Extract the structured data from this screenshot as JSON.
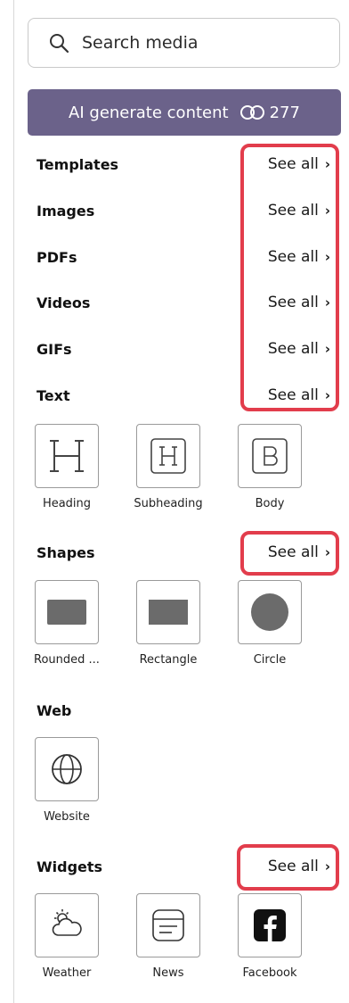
{
  "search": {
    "placeholder": "Search media",
    "icon": "search-icon"
  },
  "ai_button": {
    "label": "AI generate content",
    "credits": "277",
    "credits_icon": "credits-icon",
    "background": "#6b628a"
  },
  "sections": [
    {
      "title": "Templates",
      "see_all": "See all"
    },
    {
      "title": "Images",
      "see_all": "See all"
    },
    {
      "title": "PDFs",
      "see_all": "See all"
    },
    {
      "title": "Videos",
      "see_all": "See all"
    },
    {
      "title": "GIFs",
      "see_all": "See all"
    },
    {
      "title": "Text",
      "see_all": "See all"
    }
  ],
  "text_items": [
    {
      "label": "Heading",
      "icon": "heading-icon"
    },
    {
      "label": "Subheading",
      "icon": "subheading-icon"
    },
    {
      "label": "Body",
      "icon": "body-text-icon"
    }
  ],
  "shapes": {
    "title": "Shapes",
    "see_all": "See all",
    "items": [
      {
        "label": "Rounded ...",
        "icon": "rounded-rectangle-icon"
      },
      {
        "label": "Rectangle",
        "icon": "rectangle-icon"
      },
      {
        "label": "Circle",
        "icon": "circle-icon"
      }
    ]
  },
  "web": {
    "title": "Web",
    "items": [
      {
        "label": "Website",
        "icon": "globe-icon"
      }
    ]
  },
  "widgets": {
    "title": "Widgets",
    "see_all": "See all",
    "items": [
      {
        "label": "Weather",
        "icon": "weather-icon"
      },
      {
        "label": "News",
        "icon": "news-icon"
      },
      {
        "label": "Facebook",
        "icon": "facebook-icon"
      }
    ]
  },
  "chevron": "›",
  "highlight_color": "#e23d4c"
}
